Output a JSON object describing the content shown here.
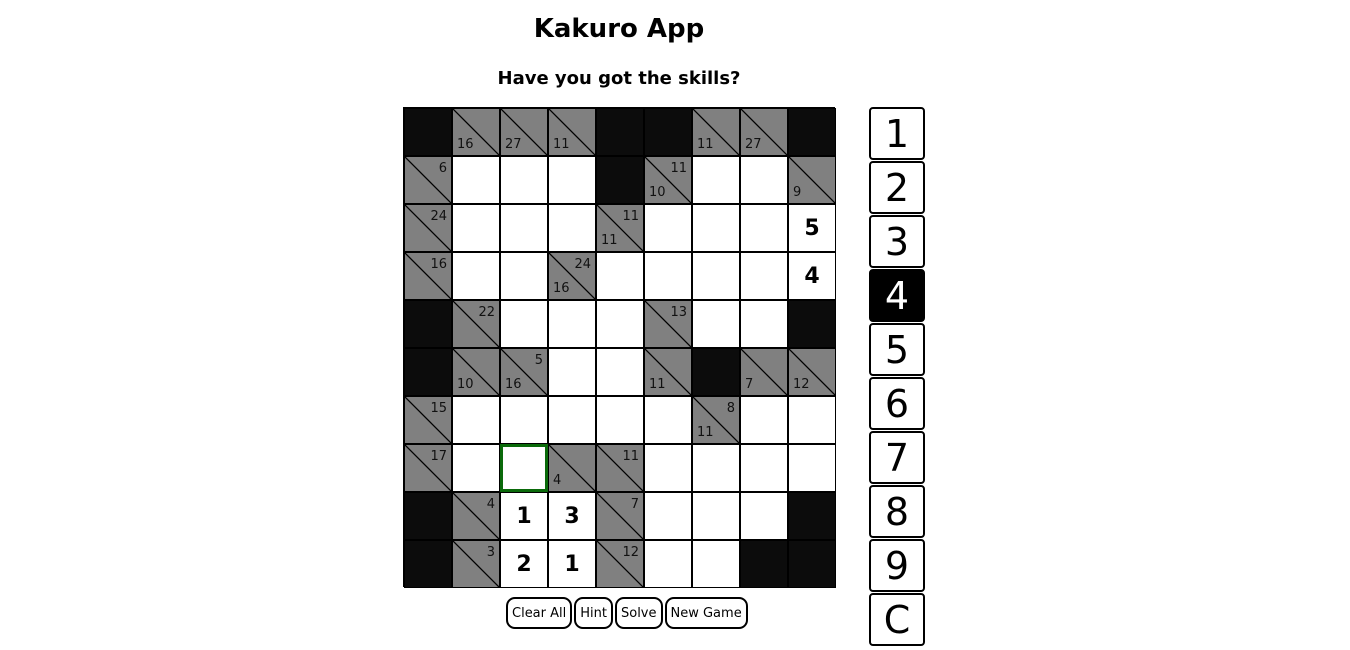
{
  "app": {
    "title": "Kakuro App",
    "subtitle": "Have you got the skills?"
  },
  "colors": {
    "black_cell": "#0c0c0c",
    "clue_cell": "#808080",
    "white_cell": "#ffffff",
    "selected_border": "#0a6a0a",
    "active_key": "#000000"
  },
  "board": {
    "rows": 10,
    "cols": 9,
    "selected": [
      7,
      2
    ],
    "cells": [
      [
        {
          "t": "b"
        },
        {
          "t": "c",
          "d": "16"
        },
        {
          "t": "c",
          "d": "27"
        },
        {
          "t": "c",
          "d": "11"
        },
        {
          "t": "b"
        },
        {
          "t": "b"
        },
        {
          "t": "c",
          "d": "11"
        },
        {
          "t": "c",
          "d": "27"
        },
        {
          "t": "b"
        }
      ],
      [
        {
          "t": "c",
          "r": "6"
        },
        {
          "t": "w",
          "v": ""
        },
        {
          "t": "w",
          "v": ""
        },
        {
          "t": "w",
          "v": ""
        },
        {
          "t": "b"
        },
        {
          "t": "c",
          "r": "11",
          "d": "10"
        },
        {
          "t": "w",
          "v": ""
        },
        {
          "t": "w",
          "v": ""
        },
        {
          "t": "c",
          "d": "9"
        }
      ],
      [
        {
          "t": "c",
          "r": "24"
        },
        {
          "t": "w",
          "v": ""
        },
        {
          "t": "w",
          "v": ""
        },
        {
          "t": "w",
          "v": ""
        },
        {
          "t": "c",
          "r": "11",
          "d": "11"
        },
        {
          "t": "w",
          "v": ""
        },
        {
          "t": "w",
          "v": ""
        },
        {
          "t": "w",
          "v": ""
        },
        {
          "t": "w",
          "v": "5"
        }
      ],
      [
        {
          "t": "c",
          "r": "16"
        },
        {
          "t": "w",
          "v": ""
        },
        {
          "t": "w",
          "v": ""
        },
        {
          "t": "c",
          "r": "24",
          "d": "16"
        },
        {
          "t": "w",
          "v": ""
        },
        {
          "t": "w",
          "v": ""
        },
        {
          "t": "w",
          "v": ""
        },
        {
          "t": "w",
          "v": ""
        },
        {
          "t": "w",
          "v": "4"
        }
      ],
      [
        {
          "t": "b"
        },
        {
          "t": "c",
          "r": "22"
        },
        {
          "t": "w",
          "v": ""
        },
        {
          "t": "w",
          "v": ""
        },
        {
          "t": "w",
          "v": ""
        },
        {
          "t": "c",
          "r": "13"
        },
        {
          "t": "w",
          "v": ""
        },
        {
          "t": "w",
          "v": ""
        },
        {
          "t": "b"
        }
      ],
      [
        {
          "t": "b"
        },
        {
          "t": "c",
          "d": "10"
        },
        {
          "t": "c",
          "r": "5",
          "d": "16"
        },
        {
          "t": "w",
          "v": ""
        },
        {
          "t": "w",
          "v": ""
        },
        {
          "t": "c",
          "d": "11"
        },
        {
          "t": "b"
        },
        {
          "t": "c",
          "d": "7"
        },
        {
          "t": "c",
          "d": "12"
        }
      ],
      [
        {
          "t": "c",
          "r": "15"
        },
        {
          "t": "w",
          "v": ""
        },
        {
          "t": "w",
          "v": ""
        },
        {
          "t": "w",
          "v": ""
        },
        {
          "t": "w",
          "v": ""
        },
        {
          "t": "w",
          "v": ""
        },
        {
          "t": "c",
          "r": "8",
          "d": "11"
        },
        {
          "t": "w",
          "v": ""
        },
        {
          "t": "w",
          "v": ""
        }
      ],
      [
        {
          "t": "c",
          "r": "17"
        },
        {
          "t": "w",
          "v": ""
        },
        {
          "t": "w",
          "v": ""
        },
        {
          "t": "c",
          "d": "4"
        },
        {
          "t": "c",
          "r": "11"
        },
        {
          "t": "w",
          "v": ""
        },
        {
          "t": "w",
          "v": ""
        },
        {
          "t": "w",
          "v": ""
        },
        {
          "t": "w",
          "v": ""
        }
      ],
      [
        {
          "t": "b"
        },
        {
          "t": "c",
          "r": "4"
        },
        {
          "t": "w",
          "v": "1"
        },
        {
          "t": "w",
          "v": "3"
        },
        {
          "t": "c",
          "r": "7"
        },
        {
          "t": "w",
          "v": ""
        },
        {
          "t": "w",
          "v": ""
        },
        {
          "t": "w",
          "v": ""
        },
        {
          "t": "b"
        }
      ],
      [
        {
          "t": "b"
        },
        {
          "t": "c",
          "r": "3"
        },
        {
          "t": "w",
          "v": "2"
        },
        {
          "t": "w",
          "v": "1"
        },
        {
          "t": "c",
          "r": "12"
        },
        {
          "t": "w",
          "v": ""
        },
        {
          "t": "w",
          "v": ""
        },
        {
          "t": "b"
        },
        {
          "t": "b"
        }
      ]
    ]
  },
  "controls": {
    "clear_all": "Clear All",
    "hint": "Hint",
    "solve": "Solve",
    "new_game": "New Game"
  },
  "numpad": {
    "keys": [
      "1",
      "2",
      "3",
      "4",
      "5",
      "6",
      "7",
      "8",
      "9",
      "C"
    ],
    "active": "4"
  }
}
